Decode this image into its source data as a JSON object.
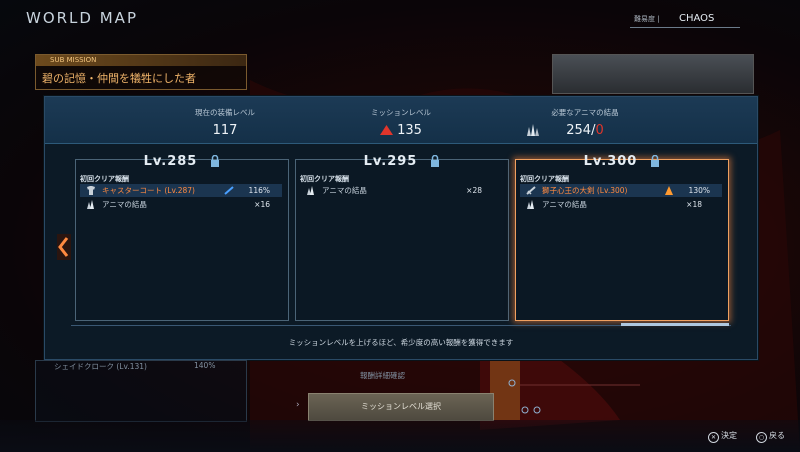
{
  "top": {
    "title": "WORLD MAP",
    "difficulty_label": "難易度 |",
    "difficulty_value": "CHAOS"
  },
  "submission": {
    "tag": "SUB MISSION",
    "title": "碧の記憶・仲間を犠牲にした者"
  },
  "header": {
    "equip_label": "現在の装備レベル",
    "equip_value": "117",
    "mission_label": "ミッションレベル",
    "mission_value": "135",
    "anima_label": "必要なアニマの結晶",
    "anima_have": "254",
    "anima_sep": "/",
    "anima_need": "0"
  },
  "cards": [
    {
      "level": "Lv.285",
      "sub": "初回クリア報酬",
      "rows": [
        {
          "icon": "armor-icon",
          "name": "キャスターコート (Lv.287)",
          "pct": "116%",
          "highlight": true
        },
        {
          "icon": "crystal-icon",
          "name": "アニマの結晶",
          "qty": "×16"
        }
      ]
    },
    {
      "level": "Lv.295",
      "sub": "初回クリア報酬",
      "rows": [
        {
          "icon": "crystal-icon",
          "name": "アニマの結晶",
          "qty": "×28"
        }
      ]
    },
    {
      "level": "Lv.300",
      "sub": "初回クリア報酬",
      "rows": [
        {
          "icon": "sword-icon",
          "name": "獅子心王の大剣 (Lv.300)",
          "pct": "130%",
          "highlight": true
        },
        {
          "icon": "crystal-icon",
          "name": "アニマの結晶",
          "qty": "×18"
        }
      ]
    }
  ],
  "footer_text": "ミッションレベルを上げるほど、希少度の高い報酬を獲得できます",
  "below": {
    "item": "シェイドクローク (Lv.131)",
    "pct": "140%",
    "reward_link": "報酬詳細確認",
    "mission_button": "ミッションレベル選択"
  },
  "hints": {
    "confirm": "決定",
    "back": "戻る"
  },
  "colors": {
    "accent_orange": "#f0a060",
    "alert_red": "#e0352b",
    "panel_bg": "#0c1a26"
  }
}
